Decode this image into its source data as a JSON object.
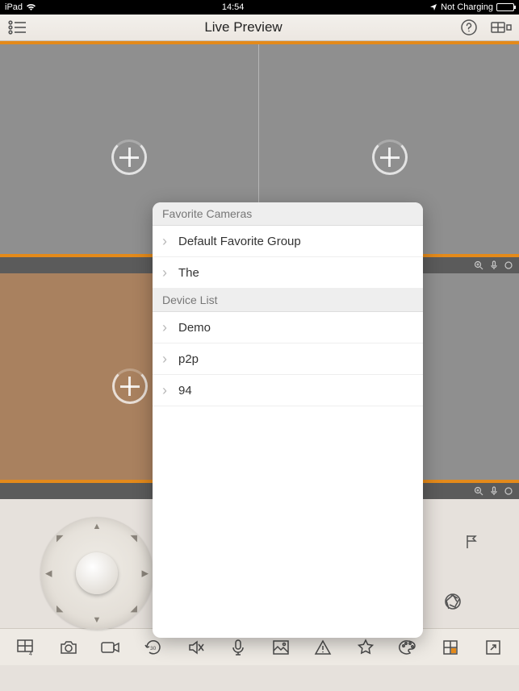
{
  "statusbar": {
    "device": "iPad",
    "time": "14:54",
    "charge": "Not Charging"
  },
  "header": {
    "title": "Live Preview"
  },
  "popover": {
    "section1_title": "Favorite Cameras",
    "section2_title": "Device List",
    "favorites": [
      {
        "label": "Default Favorite Group"
      },
      {
        "label": "The"
      }
    ],
    "devices": [
      {
        "label": "Demo"
      },
      {
        "label": "p2p"
      },
      {
        "label": "94"
      }
    ]
  }
}
